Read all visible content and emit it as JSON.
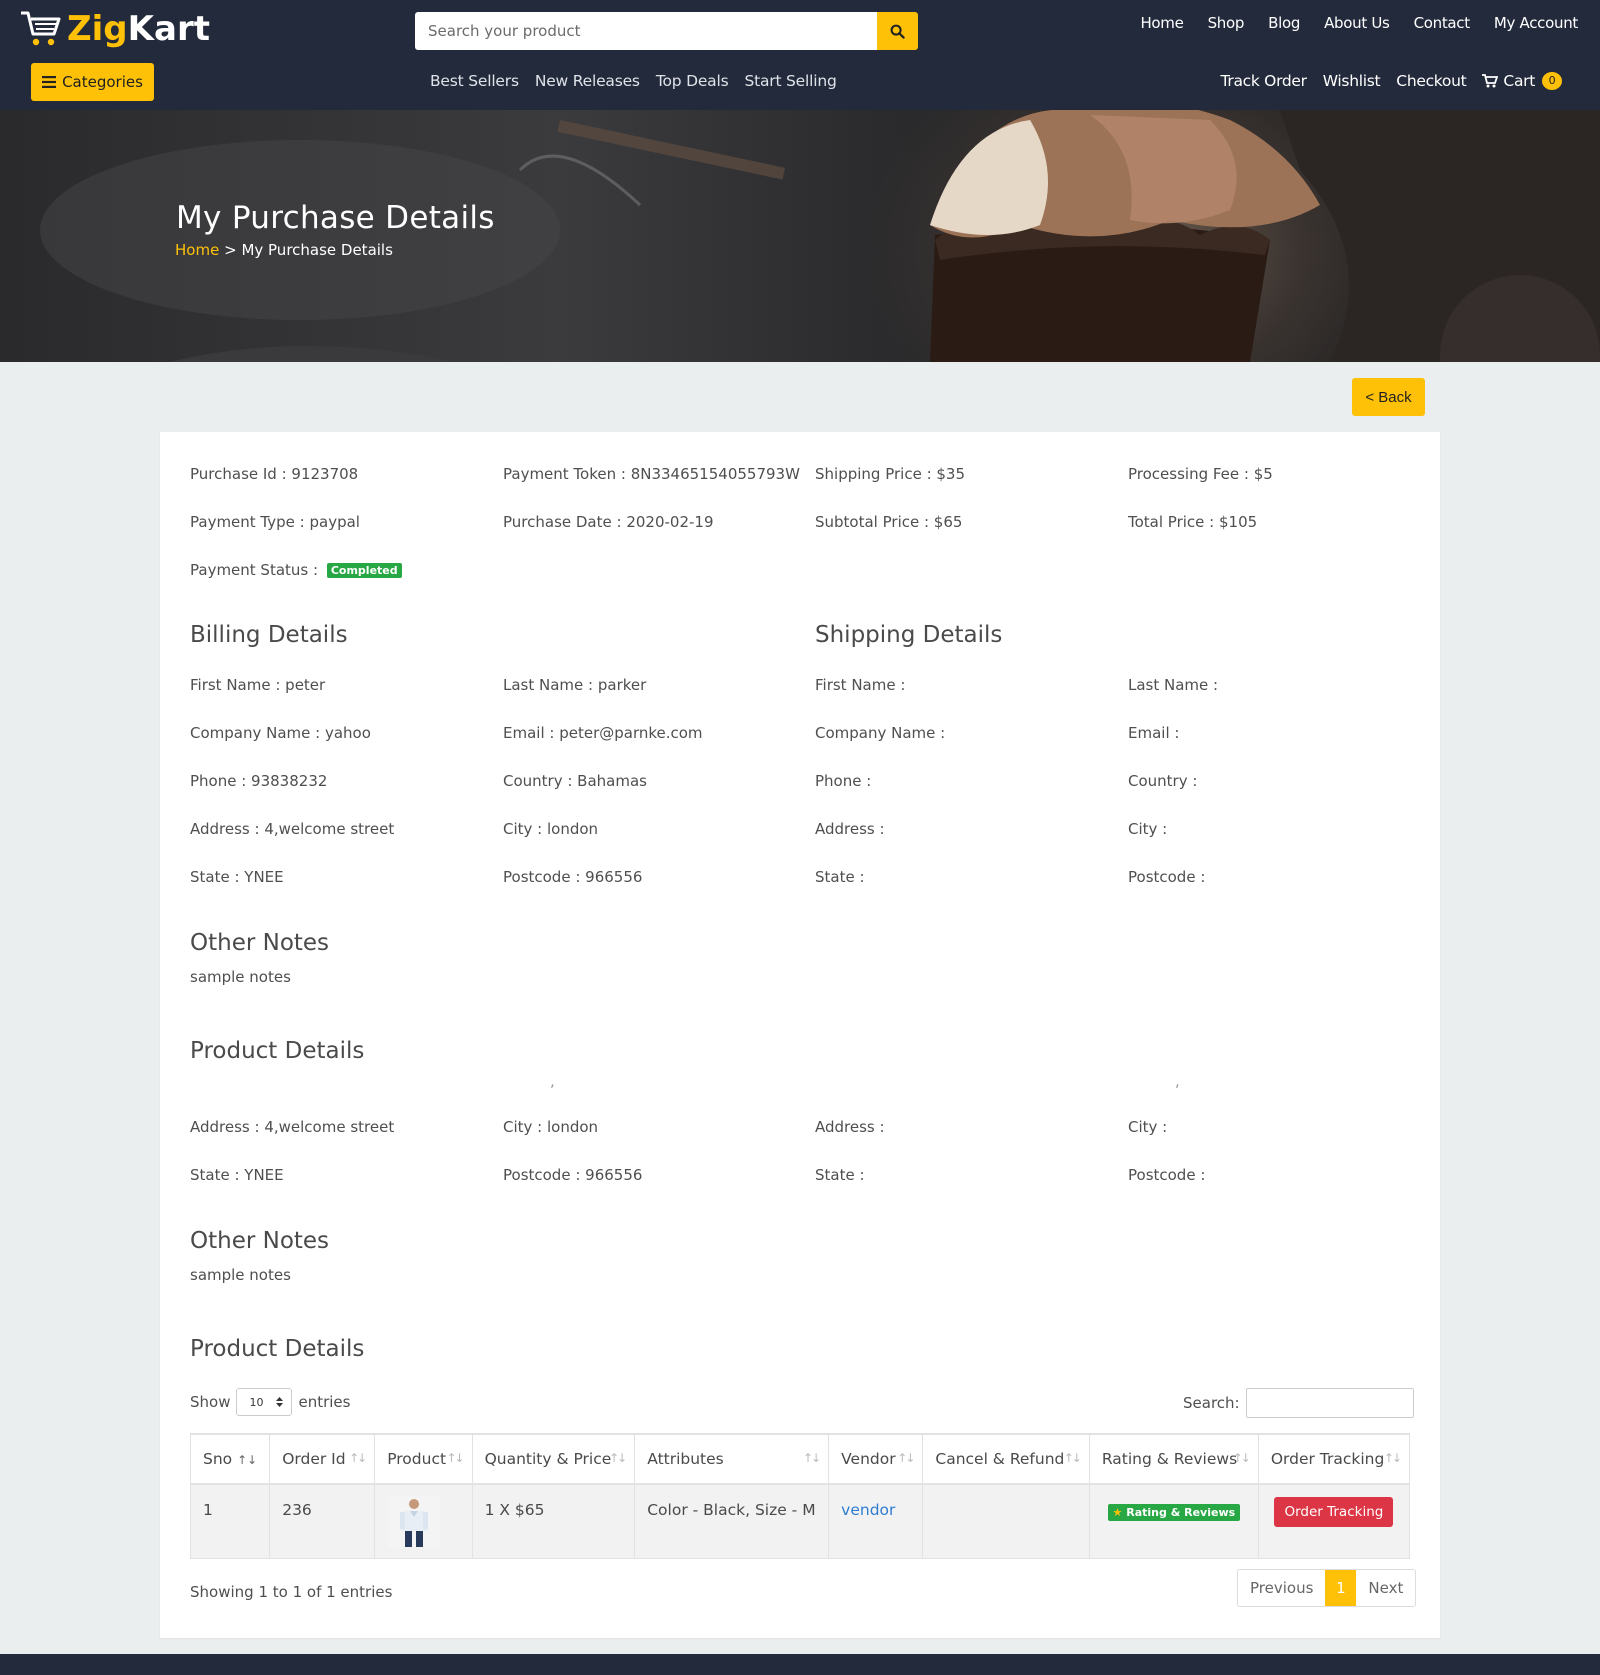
{
  "brand": {
    "logo_text_1": "Zig",
    "logo_text_2": "Kart"
  },
  "search": {
    "placeholder": "Search your product"
  },
  "top_nav": [
    "Home",
    "Shop",
    "Blog",
    "About Us",
    "Contact",
    "My Account"
  ],
  "categories_label": "Categories",
  "mid_nav": [
    "Best Sellers",
    "New Releases",
    "Top Deals",
    "Start Selling"
  ],
  "right_nav": {
    "track": "Track Order",
    "wishlist": "Wishlist",
    "checkout": "Checkout",
    "cart": "Cart",
    "cart_count": "0"
  },
  "banner": {
    "title": "My Purchase Details",
    "crumb_home": "Home",
    "crumb_sep": ">",
    "crumb_current": "My Purchase Details"
  },
  "back_label": "< Back",
  "summary": {
    "purchase_id": "Purchase Id : 9123708",
    "payment_token": "Payment Token : 8N33465154055793W",
    "shipping_price": "Shipping Price : $35",
    "processing_fee": "Processing Fee : $5",
    "payment_type": "Payment Type : paypal",
    "purchase_date": "Purchase Date : 2020-02-19",
    "subtotal_price": "Subtotal Price : $65",
    "total_price": "Total Price : $105",
    "payment_status_label": "Payment Status :",
    "payment_status": "Completed"
  },
  "billing": {
    "heading": "Billing Details",
    "first_name": "First Name : peter",
    "last_name": "Last Name : parker",
    "company": "Company Name : yahoo",
    "email": "Email : peter@parnke.com",
    "phone": "Phone : 93838232",
    "country": "Country : Bahamas",
    "address": "Address : 4,welcome street",
    "city": "City : london",
    "state": "State : YNEE",
    "postcode": "Postcode : 966556"
  },
  "shipping": {
    "heading": "Shipping Details",
    "first_name": "First Name :",
    "last_name": "Last Name :",
    "company": "Company Name :",
    "email": "Email :",
    "phone": "Phone :",
    "country": "Country :",
    "address": "Address :",
    "city": "City :",
    "state": "State :",
    "postcode": "Postcode :"
  },
  "notes": {
    "heading": "Other Notes",
    "text": "sample notes"
  },
  "product_heading": "Product Details",
  "comma": ",",
  "table": {
    "show_label": "Show",
    "show_value": "10",
    "entries_label": "entries",
    "search_label": "Search:",
    "columns": [
      "Sno",
      "Order Id",
      "Product",
      "Quantity & Price",
      "Attributes",
      "Vendor",
      "Cancel & Refund",
      "Rating & Reviews",
      "Order Tracking"
    ],
    "row": {
      "sno": "1",
      "order_id": "236",
      "qty_price": "1 X $65",
      "attributes": "Color - Black, Size - M",
      "vendor": "vendor",
      "cancel_refund": "",
      "rating_label": "Rating & Reviews",
      "tracking_label": "Order Tracking"
    },
    "showing": "Showing 1 to 1 of 1 entries",
    "prev": "Previous",
    "page": "1",
    "next": "Next"
  },
  "colors": {
    "accent": "#ffc107",
    "header_bg": "#232a3b",
    "success": "#28a745",
    "danger": "#dc3545",
    "link": "#2f7dd1"
  },
  "icons": {
    "search": "search-icon",
    "menu": "bars-icon",
    "cart": "cart-icon",
    "logo": "cart-logo-icon",
    "star": "star-icon",
    "sort": "sort-icon"
  }
}
